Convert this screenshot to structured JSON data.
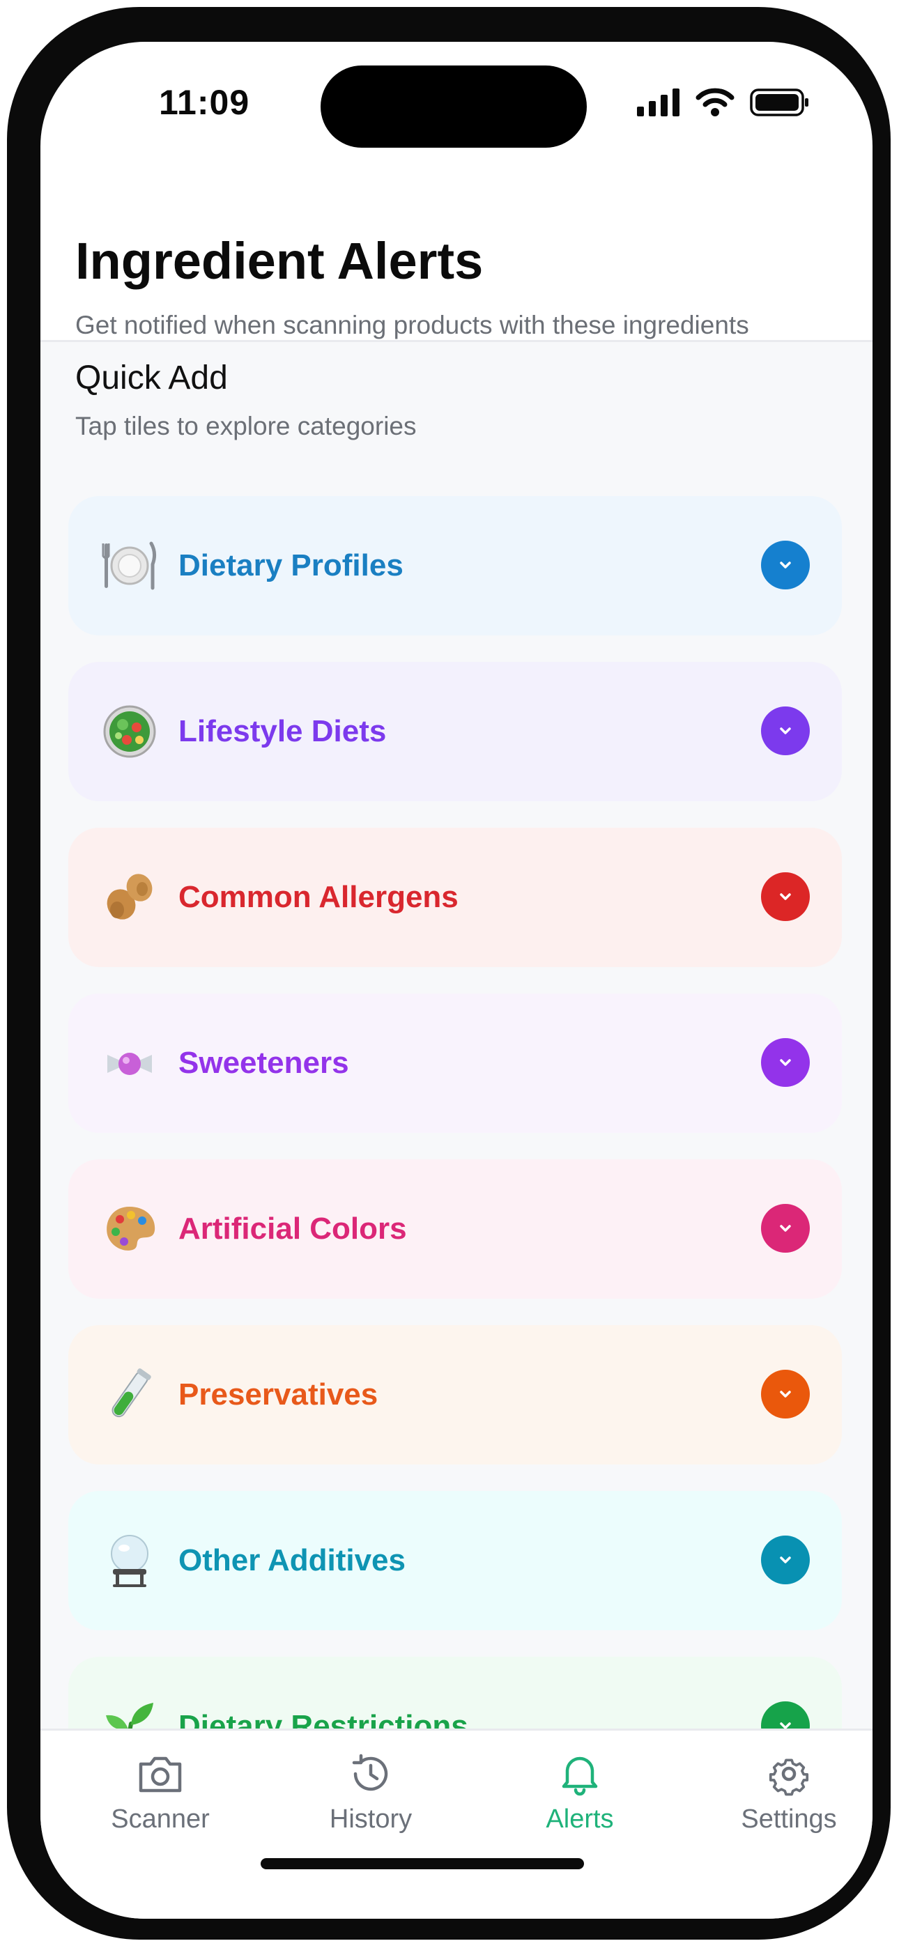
{
  "status_bar": {
    "time": "11:09"
  },
  "header": {
    "title": "Ingredient Alerts",
    "subtitle": "Get notified when scanning products with these ingredients"
  },
  "quick_add": {
    "title": "Quick Add",
    "subtitle": "Tap tiles to explore categories",
    "tiles": [
      {
        "label": "Dietary Profiles",
        "icon": "plate-icon",
        "text_color": "#1a7fc2",
        "bg_color": "#eef6fd",
        "accent": "#1580cf"
      },
      {
        "label": "Lifestyle Diets",
        "icon": "salad-icon",
        "text_color": "#7c3aed",
        "bg_color": "#f3f1fd",
        "accent": "#7c3aed"
      },
      {
        "label": "Common Allergens",
        "icon": "peanut-icon",
        "text_color": "#d9272e",
        "bg_color": "#fdf0ef",
        "accent": "#dc2626"
      },
      {
        "label": "Sweeteners",
        "icon": "candy-icon",
        "text_color": "#9333ea",
        "bg_color": "#f9f3fd",
        "accent": "#9333ea"
      },
      {
        "label": "Artificial Colors",
        "icon": "palette-icon",
        "text_color": "#db2777",
        "bg_color": "#fdf1f6",
        "accent": "#db2777"
      },
      {
        "label": "Preservatives",
        "icon": "test-tube-icon",
        "text_color": "#e8591a",
        "bg_color": "#fdf5ee",
        "accent": "#ea580c"
      },
      {
        "label": "Other Additives",
        "icon": "crystal-ball-icon",
        "text_color": "#0e94b3",
        "bg_color": "#ecfdfd",
        "accent": "#0891b2"
      },
      {
        "label": "Dietary Restrictions",
        "icon": "seedling-icon",
        "text_color": "#19a34a",
        "bg_color": "#f0fbf3",
        "accent": "#16a34a"
      }
    ]
  },
  "tab_bar": {
    "tabs": [
      {
        "label": "Scanner",
        "icon": "camera-icon",
        "active": false
      },
      {
        "label": "History",
        "icon": "history-icon",
        "active": false
      },
      {
        "label": "Alerts",
        "icon": "bell-icon",
        "active": true
      },
      {
        "label": "Settings",
        "icon": "gear-icon",
        "active": false
      }
    ],
    "active_color": "#1fb27a",
    "inactive_color": "#6b7079"
  }
}
